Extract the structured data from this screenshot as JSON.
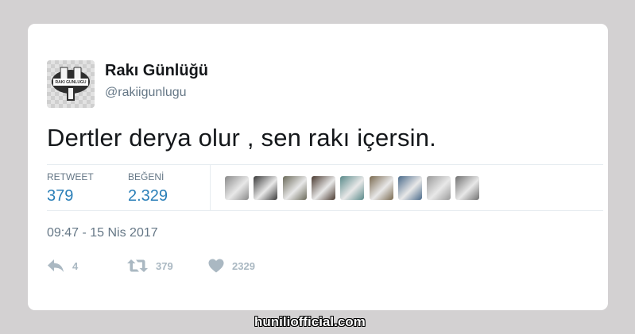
{
  "tweet": {
    "author": {
      "display_name": "Rakı Günlüğü",
      "handle": "@rakiigunlugu",
      "avatar_icon": "raki-gunlugu-logo-avatar",
      "avatar_logo_text": "RAKI GÜNLÜĞÜ"
    },
    "text": "Dertler derya olur , sen rakı içersin.",
    "stats": {
      "retweet_label": "RETWEET",
      "retweet_count": "379",
      "like_label": "BEĞENİ",
      "like_count": "2.329"
    },
    "likers": [
      {
        "icon": "liker-avatar",
        "color": "#8a8a8a"
      },
      {
        "icon": "liker-avatar",
        "color": "#3a3a3a"
      },
      {
        "icon": "liker-avatar",
        "color": "#6b6a5a"
      },
      {
        "icon": "liker-avatar",
        "color": "#4a3a30"
      },
      {
        "icon": "liker-avatar",
        "color": "#5a8a8a"
      },
      {
        "icon": "liker-avatar",
        "color": "#7a6a50"
      },
      {
        "icon": "liker-avatar",
        "color": "#4a6a8a"
      },
      {
        "icon": "liker-avatar",
        "color": "#9a9a9a"
      },
      {
        "icon": "liker-avatar",
        "color": "#707070"
      }
    ],
    "timestamp": "09:47 - 15 Nis 2017",
    "actions": {
      "reply_icon": "reply-icon",
      "reply_count": "4",
      "retweet_icon": "retweet-icon",
      "retweet_count": "379",
      "like_icon": "heart-icon",
      "like_count": "2329"
    }
  },
  "watermark": "huniliofficial.com",
  "colors": {
    "background": "#d3d1d2",
    "card": "#ffffff",
    "link_blue": "#2a7fb8",
    "muted": "#657786",
    "action_gray": "#aab8c2"
  }
}
